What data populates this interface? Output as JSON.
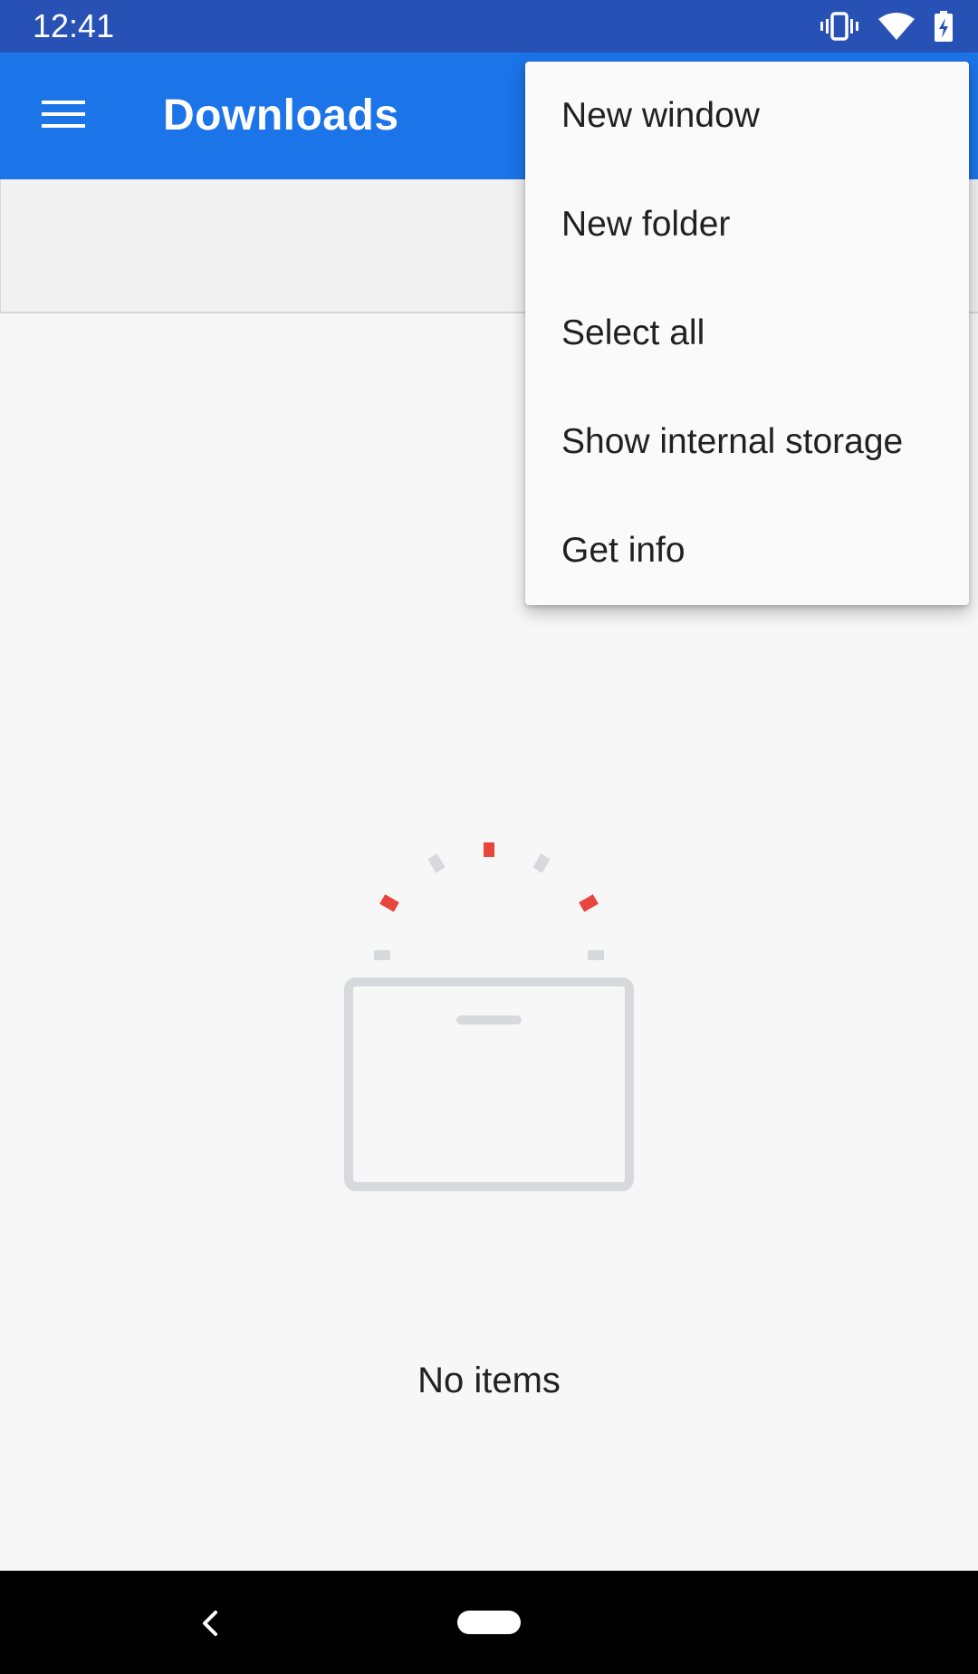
{
  "status_bar": {
    "time": "12:41",
    "icons": [
      "vibrate-icon",
      "wifi-icon",
      "battery-charging-icon"
    ]
  },
  "app_bar": {
    "title": "Downloads",
    "menu_icon": "hamburger-menu-icon",
    "color": "#1b74e8"
  },
  "overflow_menu": {
    "items": [
      {
        "label": "New window"
      },
      {
        "label": "New folder"
      },
      {
        "label": "Select all"
      },
      {
        "label": "Show internal storage"
      },
      {
        "label": "Get info"
      }
    ]
  },
  "empty_state": {
    "message": "No items",
    "icon": "empty-box-icon",
    "accent_color": "#e8453c"
  },
  "nav_bar": {
    "back_icon": "back-icon",
    "home_icon": "home-pill-icon"
  }
}
